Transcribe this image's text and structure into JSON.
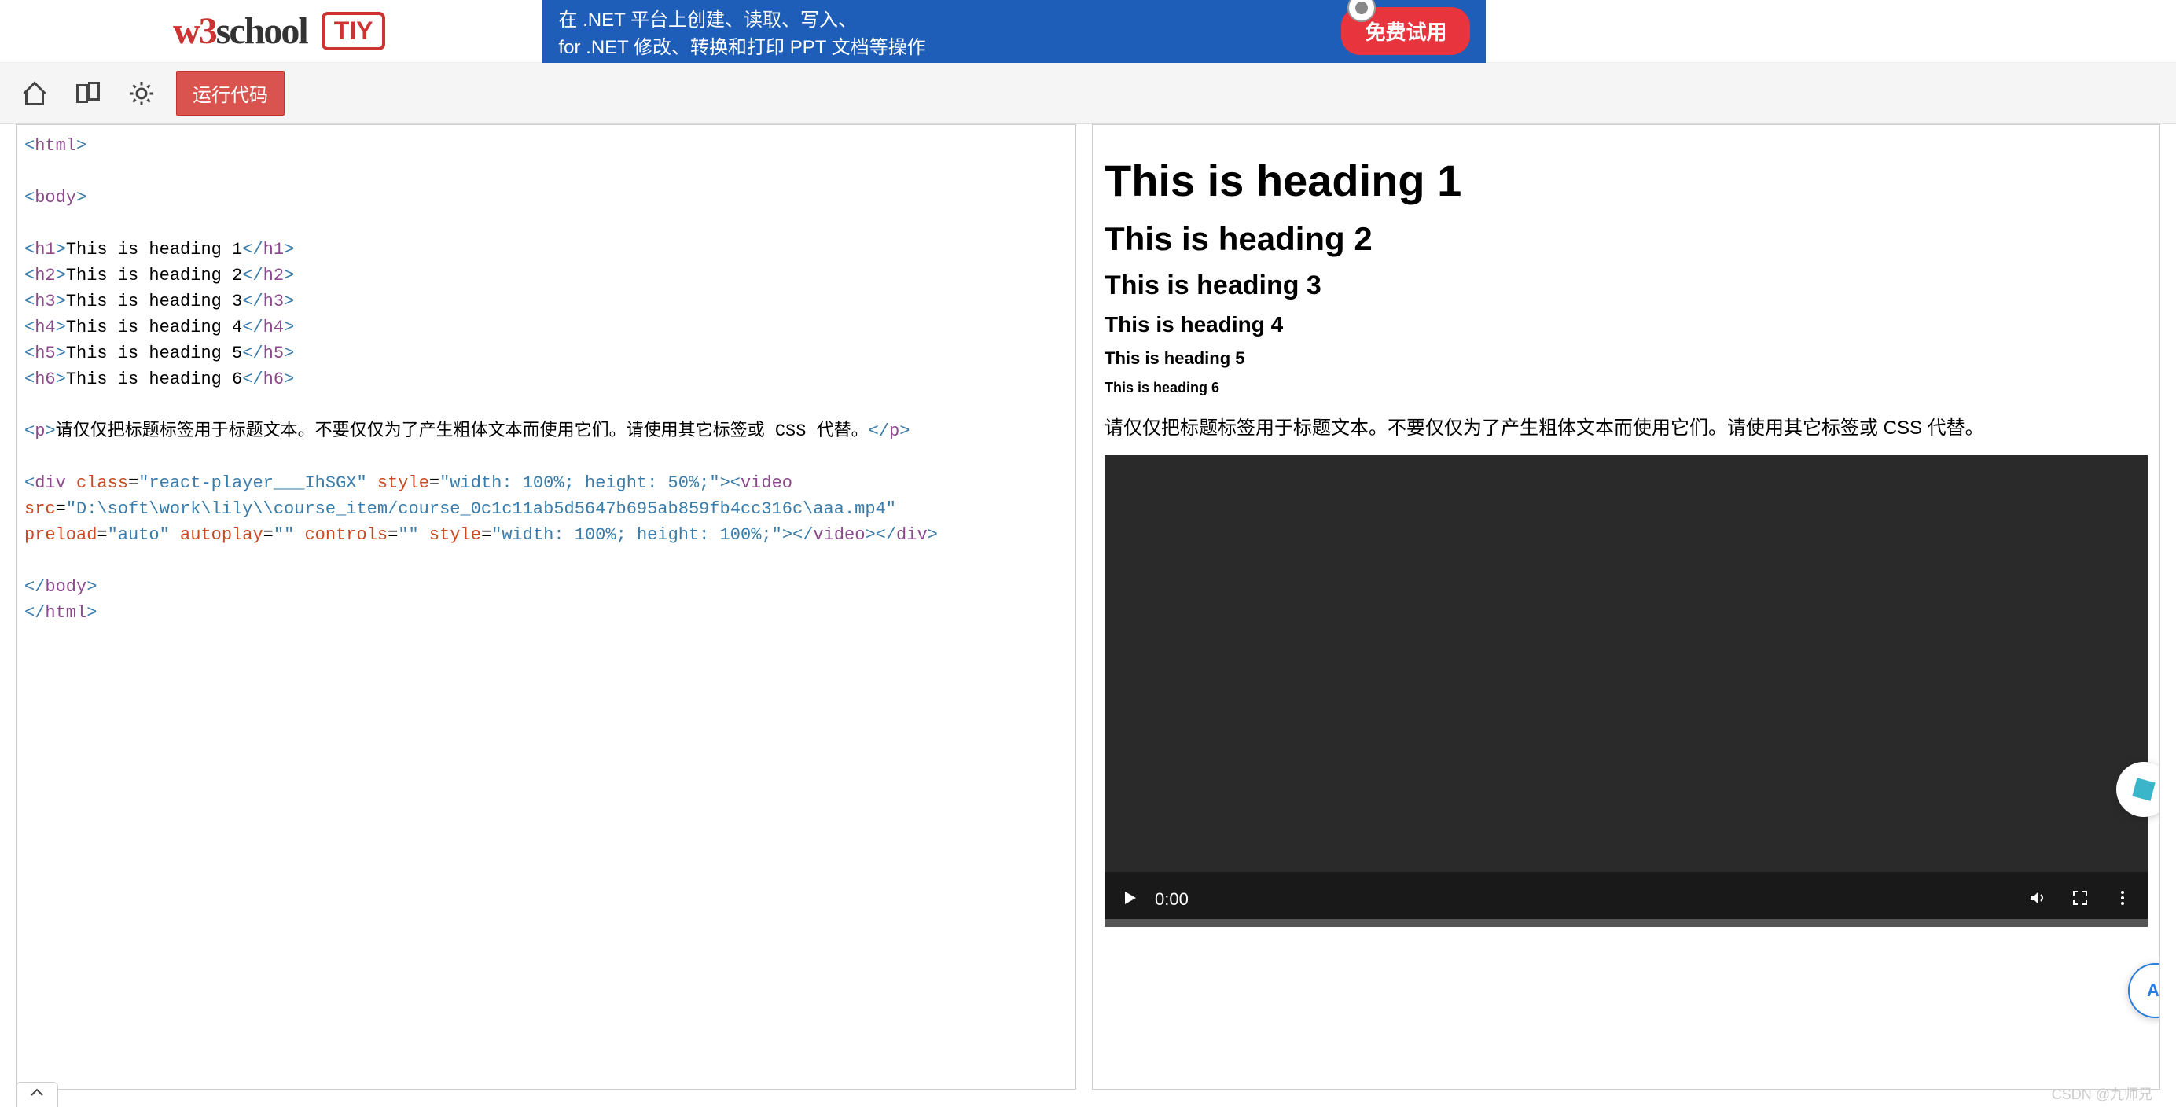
{
  "header": {
    "logo_prefix": "w3",
    "logo_suffix": "school",
    "tiy": "TIY"
  },
  "ad": {
    "line1": "在 .NET 平台上创建、读取、写入、",
    "line2": "for .NET  修改、转换和打印 PPT 文档等操作",
    "button": "免费试用"
  },
  "toolbar": {
    "run": "运行代码"
  },
  "code": {
    "l1_open": "<",
    "l1_tag": "html",
    "l1_close": ">",
    "l2_open": "<",
    "l2_tag": "body",
    "l2_close": ">",
    "h1_text": "This is heading 1",
    "h2_text": "This is heading 2",
    "h3_text": "This is heading 3",
    "h4_text": "This is heading 4",
    "h5_text": "This is heading 5",
    "h6_text": "This is heading 6",
    "p_text": "请仅仅把标题标签用于标题文本。不要仅仅为了产生粗体文本而使用它们。请使用其它标签或 CSS 代替。",
    "div_tag": "div",
    "class_attr": "class",
    "class_val": "\"react-player___IhSGX\"",
    "style_attr": "style",
    "style_val1": "\"width: 100%; height: 50%;\"",
    "video_tag": "video",
    "src_attr": "src",
    "src_val": "\"D:\\soft\\work\\lily\\\\course_item/course_0c1c11ab5d5647b695ab859fb4cc316c\\aaa.mp4\"",
    "preload_attr": "preload",
    "preload_val": "\"auto\"",
    "autoplay_attr": "autoplay",
    "autoplay_val": "\"\"",
    "controls_attr": "controls",
    "controls_val": "\"\"",
    "style_val2": "\"width: 100%; height: 100%;\""
  },
  "preview": {
    "h1": "This is heading 1",
    "h2": "This is heading 2",
    "h3": "This is heading 3",
    "h4": "This is heading 4",
    "h5": "This is heading 5",
    "h6": "This is heading 6",
    "p": "请仅仅把标题标签用于标题文本。不要仅仅为了产生粗体文本而使用它们。请使用其它标签或 CSS 代替。"
  },
  "video": {
    "time": "0:00",
    "ai_label": "Ai"
  },
  "watermark": "CSDN @九师兄"
}
